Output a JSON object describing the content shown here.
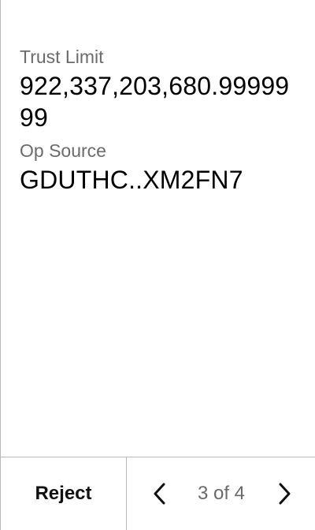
{
  "transaction": {
    "trust_limit_label": "Trust Limit",
    "trust_limit_value": "922,337,203,680.9999999",
    "op_source_label": "Op Source",
    "op_source_value": "GDUTHC..XM2FN7"
  },
  "footer": {
    "reject_label": "Reject",
    "page_indicator": "3 of 4",
    "prev_icon": "chevron-left-icon",
    "next_icon": "chevron-right-icon"
  }
}
